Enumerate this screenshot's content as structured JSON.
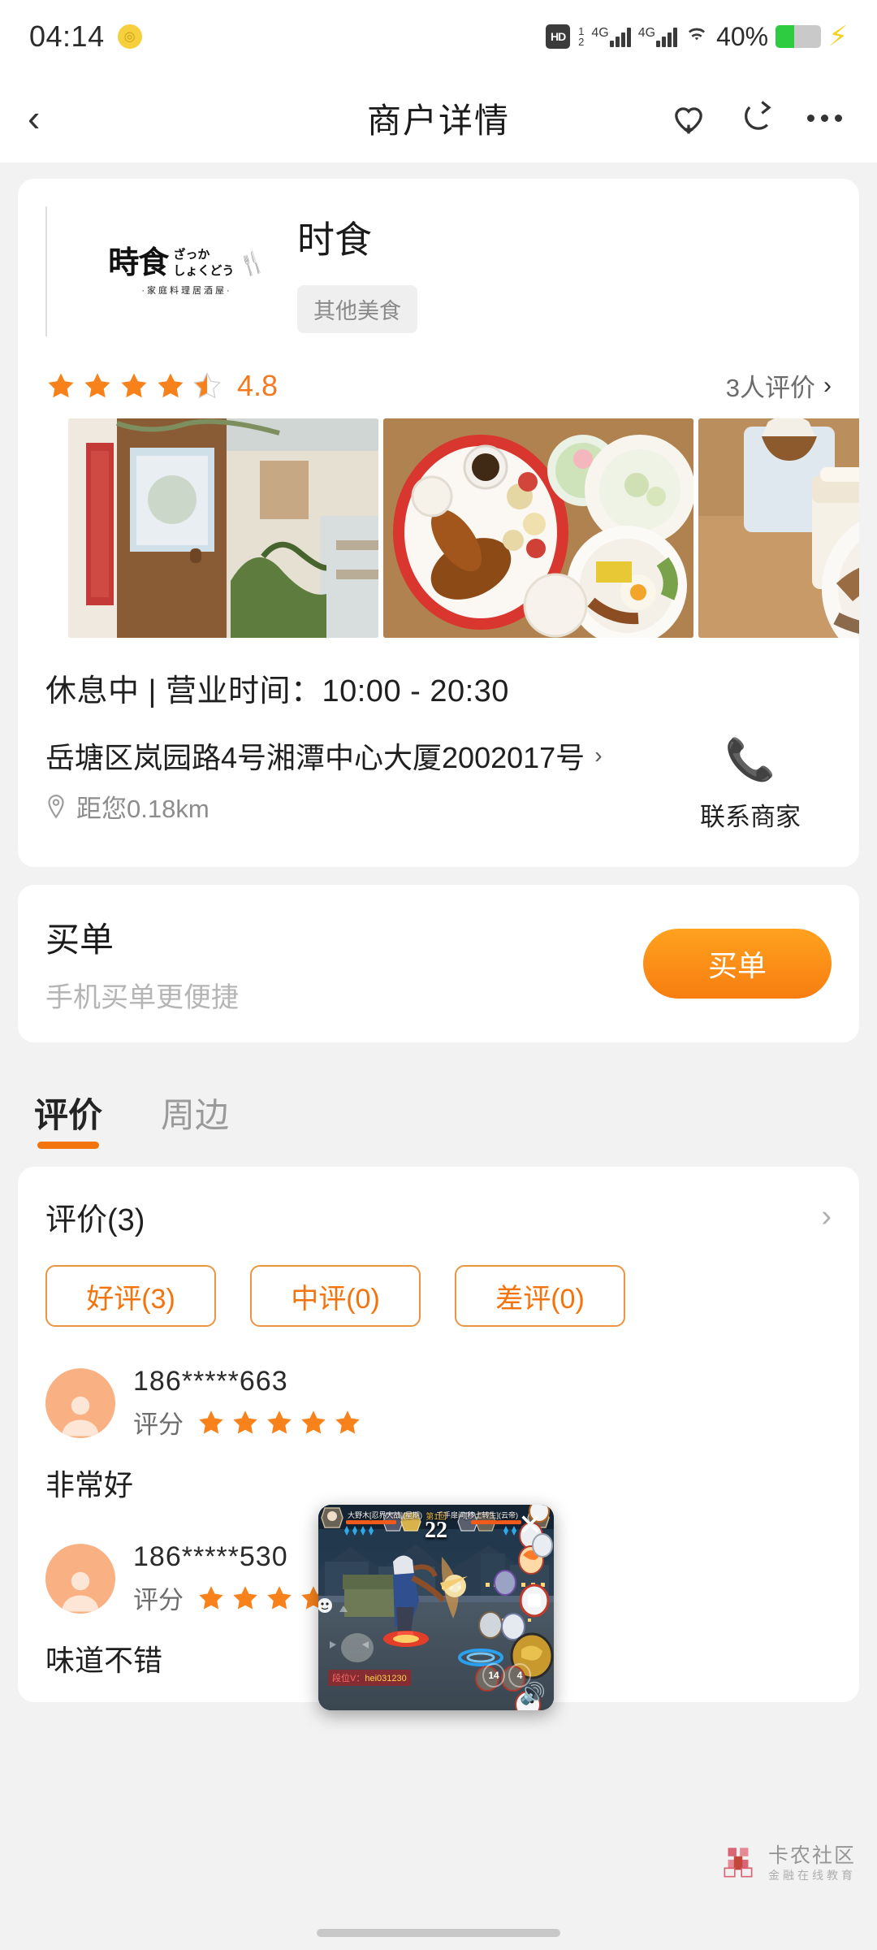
{
  "status_bar": {
    "time": "04:14",
    "dot_icon": "coin-icon",
    "hd_label": "HD",
    "hd_sub_top": "1",
    "hd_sub_bottom": "2",
    "network_1": "4G",
    "network_2": "4G",
    "wifi_icon": "wifi-icon",
    "battery_percent": "40%",
    "battery_level": 40,
    "charging_icon": "charging-bolt-icon"
  },
  "header": {
    "back_icon": "back-chevron-icon",
    "title": "商户详情",
    "favorite_icon": "heart-plus-icon",
    "share_icon": "share-icon",
    "more_icon": "more-dots-icon"
  },
  "merchant": {
    "logo": {
      "cn": "時食",
      "jp_top": "ざっか",
      "jp_bottom": "しょくどう",
      "sub": "·家庭料理居酒屋·",
      "fork_icon": "fork-spoon-icon"
    },
    "name": "时食",
    "tag": "其他美食",
    "rating_value": "4.8",
    "rating_stars": 4.5,
    "review_count_label": "3人评价",
    "review_count_chevron": "chevron-right-icon",
    "photos": [
      {
        "alt": "storefront-photo"
      },
      {
        "alt": "food-platter-photo"
      },
      {
        "alt": "drink-and-rice-bowl-photo"
      }
    ],
    "hours": "休息中 | 营业时间：10:00 - 20:30",
    "address": "岳塘区岚园路4号湘潭中心大厦2002017号",
    "address_chevron": "chevron-right-icon",
    "distance_icon": "location-pin-icon",
    "distance": "距您0.18km",
    "contact": {
      "icon": "phone-icon",
      "label": "联系商家"
    }
  },
  "pay": {
    "title": "买单",
    "subtitle": "手机买单更便捷",
    "button_label": "买单",
    "accent_color": "#f77d10"
  },
  "tabs": [
    {
      "label": "评价",
      "active": true
    },
    {
      "label": "周边",
      "active": false
    }
  ],
  "reviews_section": {
    "header": "评价(3)",
    "header_chevron": "chevron-right-icon",
    "filters": [
      {
        "label": "好评(3)"
      },
      {
        "label": "中评(0)"
      },
      {
        "label": "差评(0)"
      }
    ],
    "score_label": "评分",
    "items": [
      {
        "avatar_icon": "user-avatar-icon",
        "phone": "186*****663",
        "stars": 5,
        "text": "非常好"
      },
      {
        "avatar_icon": "user-avatar-icon",
        "phone": "186*****530",
        "stars": 5,
        "text": "味道不错"
      }
    ]
  },
  "game_overlay": {
    "close_icon": "close-x-icon",
    "player_left": "大野木[忍界大战](星期)",
    "player_right": "千手扉间[移土转生](云帝)",
    "round_label": "第1回",
    "timer": "22",
    "watermark_prefix": "段位V：",
    "watermark_name": "hei031230",
    "speaker_icon": "speaker-icon",
    "skill_count_1": "14",
    "skill_count_2": "4"
  },
  "site_watermark": {
    "logo_icon": "kanong-logo-icon",
    "title": "卡农社区",
    "subtitle": "金融在线教育"
  },
  "colors": {
    "accent_orange": "#f3730c",
    "star_orange": "#f7821b",
    "page_bg": "#f2f2f2",
    "card_bg": "#ffffff"
  }
}
